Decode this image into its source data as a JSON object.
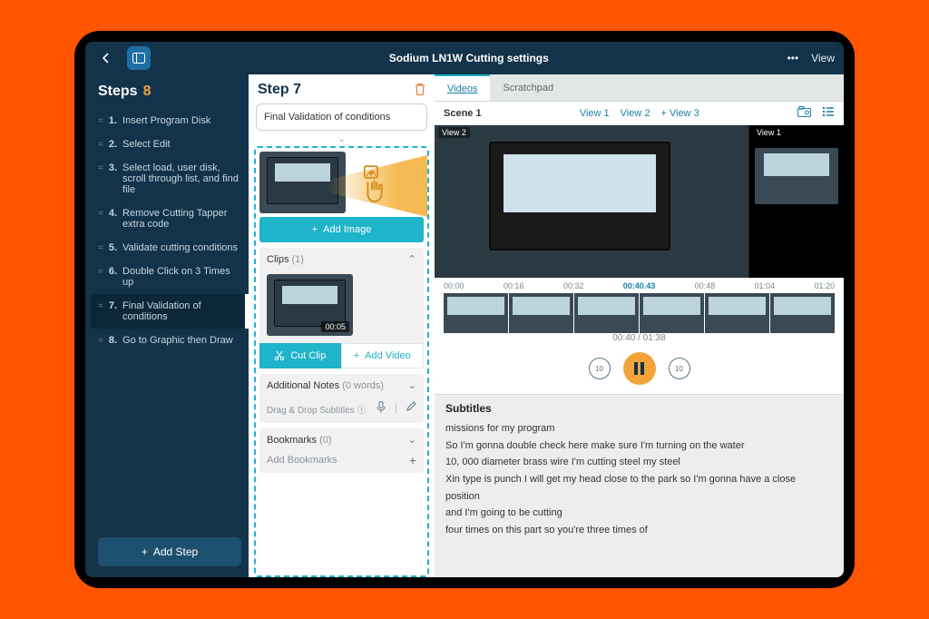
{
  "header": {
    "title": "Sodium LN1W Cutting settings",
    "view_label": "View"
  },
  "sidebar": {
    "heading": "Steps",
    "count": "8",
    "items": [
      {
        "num": "1.",
        "label": "Insert Program Disk"
      },
      {
        "num": "2.",
        "label": "Select Edit"
      },
      {
        "num": "3.",
        "label": "Select load, user disk, scroll through list, and find file"
      },
      {
        "num": "4.",
        "label": "Remove Cutting Tapper extra code"
      },
      {
        "num": "5.",
        "label": "Validate cutting conditions"
      },
      {
        "num": "6.",
        "label": "Double Click on 3 Times up"
      },
      {
        "num": "7.",
        "label": "Final Validation of conditions"
      },
      {
        "num": "8.",
        "label": "Go to Graphic then Draw"
      }
    ],
    "add_step_label": "Add Step"
  },
  "center": {
    "step_heading": "Step 7",
    "title_value": "Final Validation of conditions",
    "add_image_label": "Add Image",
    "clips_label": "Clips",
    "clips_count": "(1)",
    "clip_duration": "00:05",
    "cut_clip_label": "Cut Clip",
    "add_video_label": "Add Video",
    "notes_label": "Additional Notes",
    "notes_count": "(0 words)",
    "drag_subtitles_label": "Drag & Drop Subtitles",
    "bookmarks_label": "Bookmarks",
    "bookmarks_count": "(0)",
    "add_bookmarks_label": "Add Bookmarks"
  },
  "rightpane": {
    "tabs": {
      "videos": "Videos",
      "scratchpad": "Scratchpad"
    },
    "scene": {
      "label": "Scene 1",
      "view1": "View 1",
      "view2": "View 2",
      "view3": "View 3"
    },
    "video": {
      "main_label": "View 2",
      "side_label": "View 1"
    },
    "timeline_ticks": [
      "00:00",
      "00:16",
      "00:32",
      "00:40.43",
      "00:48",
      "01:04",
      "01:20"
    ],
    "playback_time": "00:40 / 01:38",
    "skip_seconds": "10",
    "subtitles_heading": "Subtitles",
    "subtitles": [
      "missions for my program",
      "So I'm gonna double check here make sure I'm turning on the water",
      "10, 000 diameter brass wire I'm cutting steel my steel",
      "Xin type is punch I will get my head close to the park so I'm gonna have a close position",
      "and I'm going to be cutting",
      "four times on this part so you're three times of"
    ]
  }
}
